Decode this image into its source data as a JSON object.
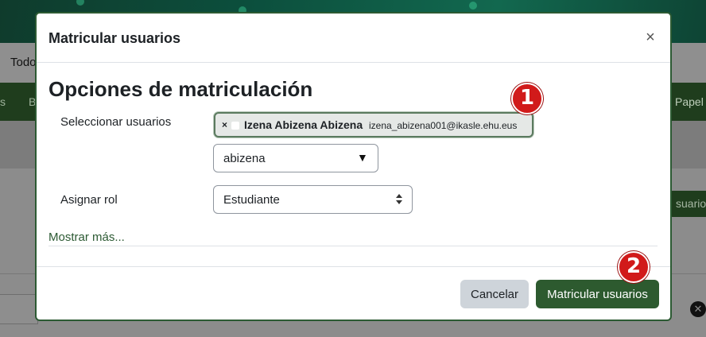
{
  "background": {
    "top_text": "Todo",
    "nav_left_1": "s",
    "nav_left_2": "B",
    "nav_right": "Papel",
    "side_button": "suarios"
  },
  "modal": {
    "title": "Matricular usuarios",
    "close_glyph": "×",
    "section_title": "Opciones de matriculación",
    "select_users_label": "Seleccionar usuarios",
    "selected_user": {
      "remove_glyph": "×",
      "name": "Izena Abizena Abizena",
      "email": "izena_abizena001@ikasle.ehu.eus"
    },
    "search": {
      "value": "abizena",
      "caret": "▼"
    },
    "assign_role_label": "Asignar rol",
    "role_value": "Estudiante",
    "show_more": "Mostrar más...",
    "cancel_label": "Cancelar",
    "submit_label": "Matricular usuarios"
  },
  "callouts": [
    "1",
    "2"
  ],
  "colors": {
    "primary": "#2d5a2f",
    "callout": "#d11a1a",
    "link": "#2c5a33"
  }
}
